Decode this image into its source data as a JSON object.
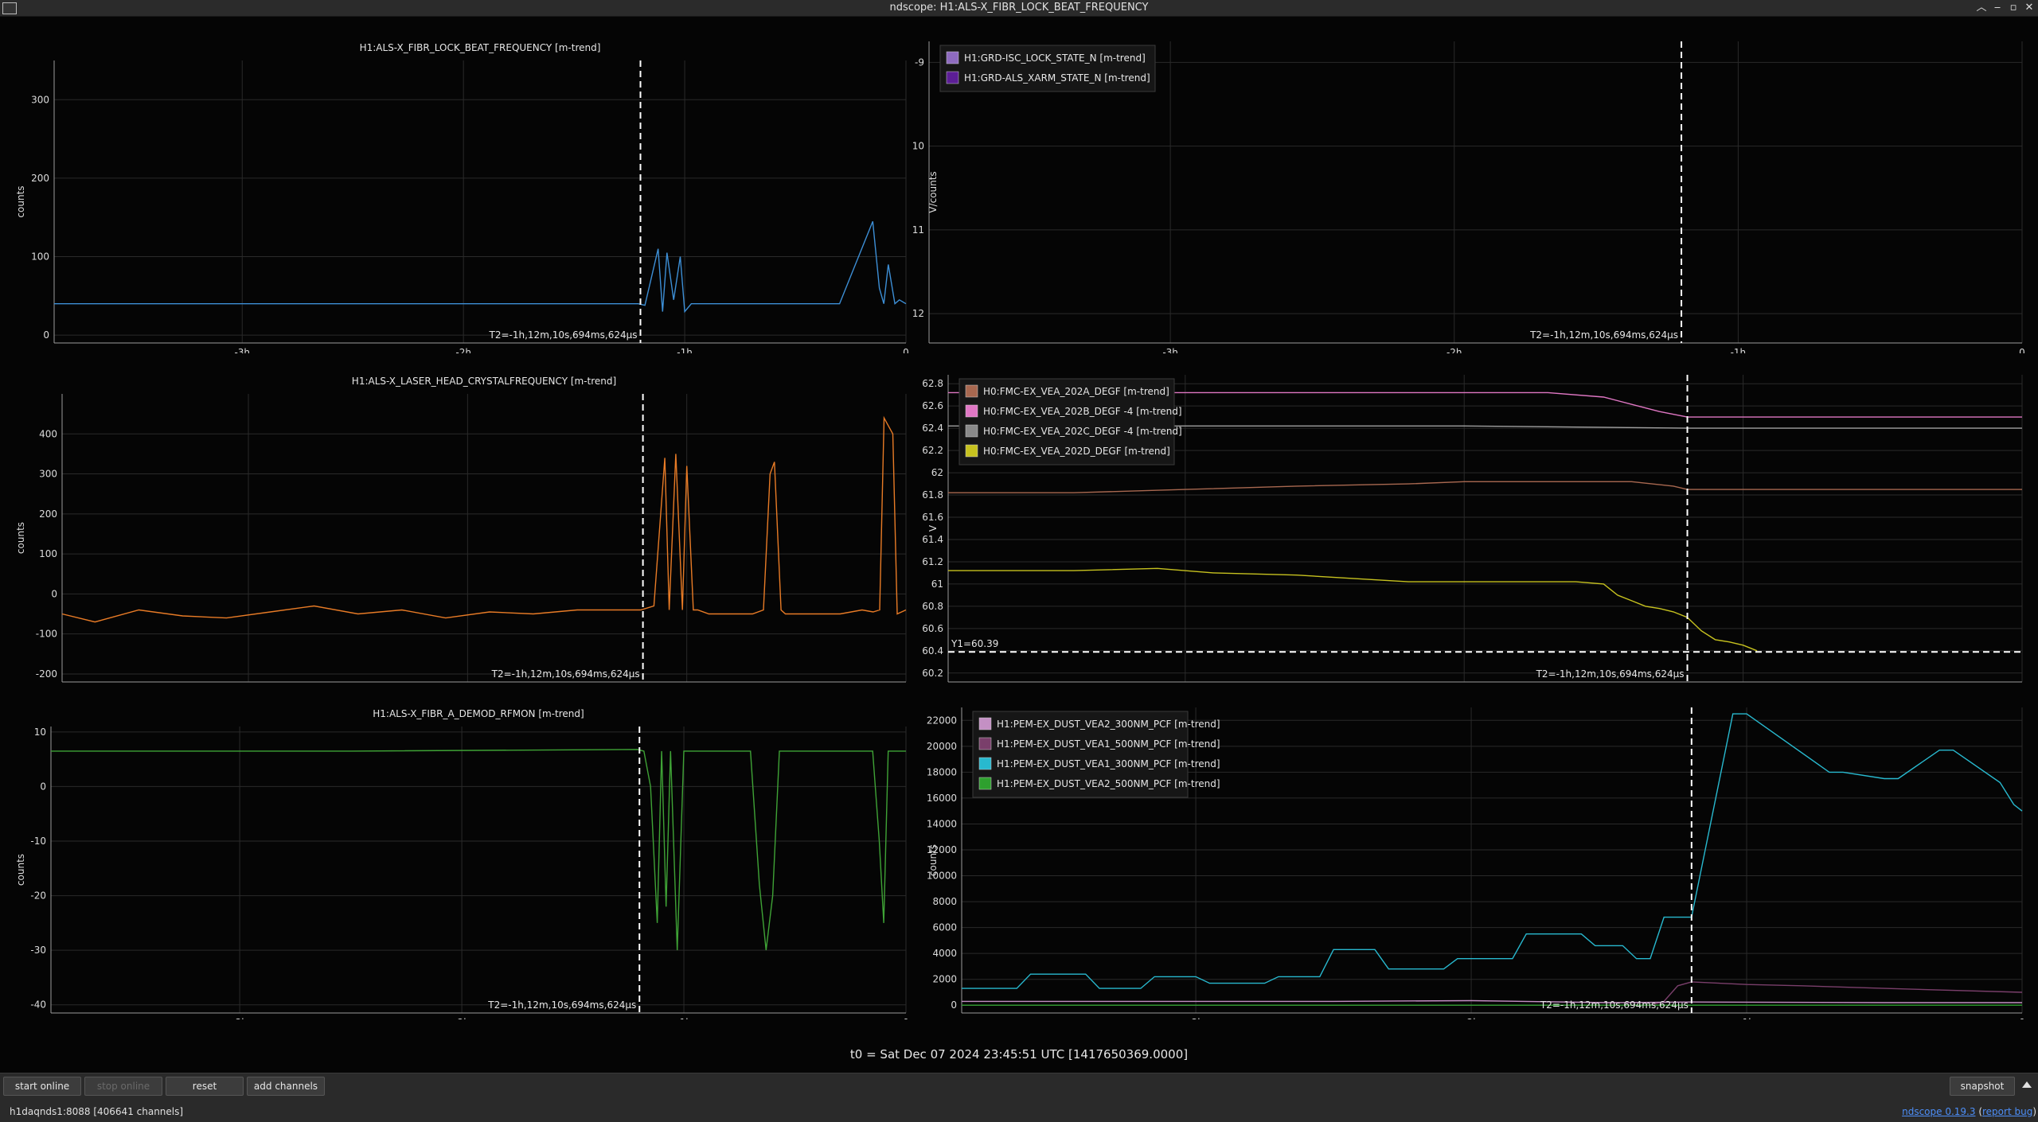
{
  "window": {
    "title": "ndscope: H1:ALS-X_FIBR_LOCK_BEAT_FREQUENCY",
    "controls": [
      "︿",
      "‒",
      "▫",
      "✕"
    ]
  },
  "x_ticks": [
    "-3h",
    "-2h",
    "-1h",
    "0"
  ],
  "cursor_label": "T2=-1h,12m,10s,694ms,624µs",
  "t0_label": "t0 = Sat Dec 07 2024 23:45:51 UTC [1417650369.0000]",
  "toolbar": {
    "start_online": "start online",
    "stop_online": "stop online",
    "reset": "reset",
    "add_channels": "add channels",
    "snapshot": "snapshot"
  },
  "status": {
    "server": "h1daqnds1:8088  [406641 channels]",
    "version_link": "ndscope 0.19.3",
    "report_prefix": " (",
    "report_link": "report bug",
    "report_suffix": ")"
  },
  "chart_data": [
    {
      "type": "line",
      "title": "H1:ALS-X_FIBR_LOCK_BEAT_FREQUENCY [m-trend]",
      "ylabel": "counts",
      "yticks": [
        "0",
        "100",
        "200",
        "300"
      ],
      "ylim": [
        -10,
        350
      ],
      "xlim": [
        -3.85,
        0
      ],
      "cursor_x": -1.2,
      "series": [
        {
          "color": "#3d8fd6",
          "x": [
            -3.85,
            -1.21,
            -1.18,
            -1.12,
            -1.1,
            -1.08,
            -1.05,
            -1.02,
            -1.0,
            -0.97,
            -0.94,
            -0.7,
            -0.68,
            -0.65,
            -0.62,
            -0.6,
            -0.57,
            -0.5,
            -0.48,
            -0.45,
            -0.4,
            -0.35,
            -0.3,
            -0.15,
            -0.12,
            -0.1,
            -0.08,
            -0.05,
            -0.03,
            0.0
          ],
          "y": [
            40,
            40,
            38,
            110,
            30,
            105,
            45,
            100,
            30,
            40,
            40,
            40,
            40,
            40,
            40,
            40,
            40,
            40,
            40,
            40,
            40,
            40,
            40,
            145,
            60,
            40,
            90,
            40,
            45,
            40
          ]
        }
      ]
    },
    {
      "type": "line",
      "title": "",
      "ylabel": "V/counts",
      "yticks": [
        "-9",
        "-10",
        "-11",
        "-12"
      ],
      "ylim": [
        -12.35,
        -8.75
      ],
      "xlim": [
        -3.85,
        0
      ],
      "cursor_x": -1.2,
      "legend": [
        {
          "label": "H1:GRD-ISC_LOCK_STATE_N [m-trend]",
          "color": "#8e6bbf"
        },
        {
          "label": "H1:GRD-ALS_XARM_STATE_N [m-trend]",
          "color": "#5c1e96"
        }
      ],
      "series": []
    },
    {
      "type": "line",
      "title": "H1:ALS-X_LASER_HEAD_CRYSTALFREQUENCY [m-trend]",
      "ylabel": "counts",
      "yticks": [
        "400",
        "300",
        "200",
        "100",
        "0",
        "-100",
        "-200"
      ],
      "ylim": [
        -220,
        500
      ],
      "xlim": [
        -3.85,
        0
      ],
      "cursor_x": -1.2,
      "series": [
        {
          "color": "#e87b26",
          "x": [
            -3.85,
            -3.7,
            -3.5,
            -3.3,
            -3.1,
            -2.9,
            -2.7,
            -2.5,
            -2.3,
            -2.1,
            -1.9,
            -1.7,
            -1.5,
            -1.3,
            -1.21,
            -1.15,
            -1.1,
            -1.08,
            -1.05,
            -1.02,
            -1.0,
            -0.97,
            -0.95,
            -0.9,
            -0.7,
            -0.65,
            -0.62,
            -0.6,
            -0.57,
            -0.55,
            -0.3,
            -0.2,
            -0.15,
            -0.12,
            -0.1,
            -0.06,
            -0.04,
            0.0
          ],
          "y": [
            -50,
            -70,
            -40,
            -55,
            -60,
            -45,
            -30,
            -50,
            -40,
            -60,
            -45,
            -50,
            -40,
            -40,
            -40,
            -30,
            340,
            -40,
            350,
            -40,
            320,
            -40,
            -40,
            -50,
            -50,
            -40,
            300,
            330,
            -40,
            -50,
            -50,
            -40,
            -45,
            -40,
            440,
            400,
            -50,
            -40
          ]
        }
      ]
    },
    {
      "type": "line",
      "title": "",
      "ylabel": "V",
      "yticks": [
        "62.8",
        "62.6",
        "62.4",
        "62.2",
        "62",
        "61.8",
        "61.6",
        "61.4",
        "61.2",
        "61",
        "60.8",
        "60.6",
        "60.4",
        "60.2"
      ],
      "ylim": [
        60.12,
        62.88
      ],
      "xlim": [
        -3.85,
        0
      ],
      "cursor_x": -1.2,
      "cursor_y": 60.39,
      "cursor_y_label": "Y1=60.39",
      "legend": [
        {
          "label": "H0:FMC-EX_VEA_202A_DEGF [m-trend]",
          "color": "#a86850"
        },
        {
          "label": "H0:FMC-EX_VEA_202B_DEGF -4 [m-trend]",
          "color": "#e077c4"
        },
        {
          "label": "H0:FMC-EX_VEA_202C_DEGF -4 [m-trend]",
          "color": "#8a8a8a"
        },
        {
          "label": "H0:FMC-EX_VEA_202D_DEGF [m-trend]",
          "color": "#c7c21f"
        }
      ],
      "series": [
        {
          "color": "#e077c4",
          "x": [
            -3.85,
            -2.0,
            -1.7,
            -1.5,
            -1.3,
            -1.2,
            -0.8,
            0.0
          ],
          "y": [
            62.72,
            62.72,
            62.72,
            62.68,
            62.55,
            62.5,
            62.5,
            62.5
          ]
        },
        {
          "color": "#a0a0a0",
          "x": [
            -3.85,
            -2.0,
            -1.2,
            -0.8,
            0.0
          ],
          "y": [
            62.42,
            62.42,
            62.4,
            62.4,
            62.4
          ]
        },
        {
          "color": "#a86850",
          "x": [
            -3.85,
            -3.4,
            -3.0,
            -2.6,
            -2.2,
            -2.0,
            -1.7,
            -1.4,
            -1.25,
            -1.2,
            -0.9,
            -0.5,
            0.0
          ],
          "y": [
            61.82,
            61.82,
            61.85,
            61.88,
            61.9,
            61.92,
            61.92,
            61.92,
            61.88,
            61.85,
            61.85,
            61.85,
            61.85
          ]
        },
        {
          "color": "#c7c21f",
          "x": [
            -3.85,
            -3.4,
            -3.1,
            -2.9,
            -2.6,
            -2.4,
            -2.2,
            -2.0,
            -1.8,
            -1.7,
            -1.6,
            -1.5,
            -1.45,
            -1.4,
            -1.35,
            -1.3,
            -1.25,
            -1.2,
            -1.15,
            -1.1,
            -1.05,
            -1.0,
            -0.95
          ],
          "y": [
            61.12,
            61.12,
            61.14,
            61.1,
            61.08,
            61.05,
            61.02,
            61.02,
            61.02,
            61.02,
            61.02,
            61.0,
            60.9,
            60.85,
            60.8,
            60.78,
            60.75,
            60.7,
            60.58,
            60.5,
            60.48,
            60.45,
            60.4
          ]
        }
      ]
    },
    {
      "type": "line",
      "title": "H1:ALS-X_FIBR_A_DEMOD_RFMON [m-trend]",
      "ylabel": "counts",
      "yticks": [
        "10",
        "0",
        "-10",
        "-20",
        "-30",
        "-40"
      ],
      "ylim": [
        -41.5,
        11
      ],
      "xlim": [
        -3.85,
        0
      ],
      "cursor_x": -1.2,
      "series": [
        {
          "color": "#3fa336",
          "x": [
            -3.85,
            -2.5,
            -1.21,
            -1.18,
            -1.15,
            -1.12,
            -1.1,
            -1.08,
            -1.06,
            -1.03,
            -1.0,
            -0.97,
            -0.95,
            -0.7,
            -0.66,
            -0.63,
            -0.6,
            -0.57,
            -0.55,
            -0.2,
            -0.15,
            -0.12,
            -0.1,
            -0.08,
            -0.05,
            0.0
          ],
          "y": [
            6.5,
            6.5,
            6.8,
            6.5,
            0,
            -25,
            6.5,
            -22,
            6.5,
            -30,
            6.5,
            6.5,
            6.5,
            6.5,
            -18,
            -30,
            -20,
            6.5,
            6.5,
            6.5,
            6.5,
            -10,
            -25,
            6.5,
            6.5,
            6.5
          ]
        }
      ]
    },
    {
      "type": "line",
      "title": "",
      "ylabel": "counts",
      "yticks": [
        "22000",
        "20000",
        "18000",
        "16000",
        "14000",
        "12000",
        "10000",
        "8000",
        "6000",
        "4000",
        "2000",
        "0"
      ],
      "ylim": [
        -600,
        23000
      ],
      "xlim": [
        -3.85,
        0
      ],
      "cursor_x": -1.2,
      "legend": [
        {
          "label": "H1:PEM-EX_DUST_VEA2_300NM_PCF [m-trend]",
          "color": "#c490c4"
        },
        {
          "label": "H1:PEM-EX_DUST_VEA1_500NM_PCF [m-trend]",
          "color": "#7a3f6b"
        },
        {
          "label": "H1:PEM-EX_DUST_VEA1_300NM_PCF [m-trend]",
          "color": "#28b9cf"
        },
        {
          "label": "H1:PEM-EX_DUST_VEA2_500NM_PCF [m-trend]",
          "color": "#2ea02e"
        }
      ],
      "series": [
        {
          "color": "#28b9cf",
          "x": [
            -3.85,
            -3.65,
            -3.6,
            -3.4,
            -3.35,
            -3.2,
            -3.15,
            -3.0,
            -2.95,
            -2.75,
            -2.7,
            -2.55,
            -2.5,
            -2.35,
            -2.3,
            -2.1,
            -2.05,
            -1.85,
            -1.8,
            -1.6,
            -1.55,
            -1.45,
            -1.4,
            -1.35,
            -1.3,
            -1.2,
            -1.05,
            -1.0,
            -0.7,
            -0.65,
            -0.5,
            -0.45,
            -0.3,
            -0.25,
            -0.08,
            -0.03,
            0.0
          ],
          "y": [
            1300,
            1300,
            2400,
            2400,
            1300,
            1300,
            2200,
            2200,
            1700,
            1700,
            2200,
            2200,
            4300,
            4300,
            2800,
            2800,
            3600,
            3600,
            5500,
            5500,
            4600,
            4600,
            3600,
            3600,
            6800,
            6800,
            22500,
            22500,
            18000,
            18000,
            17500,
            17500,
            19700,
            19700,
            17200,
            15500,
            15000
          ]
        },
        {
          "color": "#7a3f6b",
          "x": [
            -3.85,
            -1.35,
            -1.3,
            -1.25,
            -1.2,
            -1.0,
            -0.8,
            -0.5,
            0.0
          ],
          "y": [
            0,
            0,
            300,
            1500,
            1800,
            1600,
            1500,
            1300,
            1000
          ]
        },
        {
          "color": "#c490c4",
          "x": [
            -3.85,
            -2.5,
            -2.0,
            -1.5,
            -1.2,
            -0.5,
            0.0
          ],
          "y": [
            300,
            300,
            350,
            200,
            250,
            200,
            200
          ]
        },
        {
          "color": "#2ea02e",
          "x": [
            -3.85,
            -2.0,
            -1.2,
            0.0
          ],
          "y": [
            0,
            0,
            0,
            0
          ]
        }
      ]
    }
  ]
}
